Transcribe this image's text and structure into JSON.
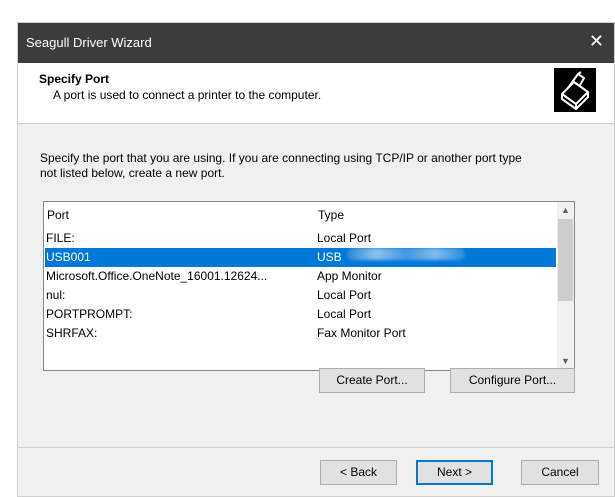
{
  "window": {
    "title": "Seagull Driver Wizard",
    "close_glyph": "✕"
  },
  "header": {
    "title": "Specify Port",
    "subtitle": "A port is used to connect a printer to the computer.",
    "logo_icon": "printer-icon"
  },
  "description": {
    "line1": "Specify the port that you are using.  If you are connecting using TCP/IP or another port type",
    "line2": "not listed below, create a new port."
  },
  "port_list": {
    "columns": [
      "Port",
      "Type"
    ],
    "rows": [
      {
        "port": "FILE:",
        "type": "Local Port"
      },
      {
        "port": "USB001",
        "type": "USB",
        "selected": true
      },
      {
        "port": "Microsoft.Office.OneNote_16001.12624...",
        "type": "App Monitor"
      },
      {
        "port": "nul:",
        "type": "Local Port"
      },
      {
        "port": "PORTPROMPT:",
        "type": "Local Port"
      },
      {
        "port": "SHRFAX:",
        "type": "Fax Monitor Port"
      }
    ],
    "selected_color": "#0078d7"
  },
  "buttons": {
    "create_port": "Create Port...",
    "configure_port": "Configure Port...",
    "back": "< Back",
    "next": "Next >",
    "cancel": "Cancel"
  }
}
